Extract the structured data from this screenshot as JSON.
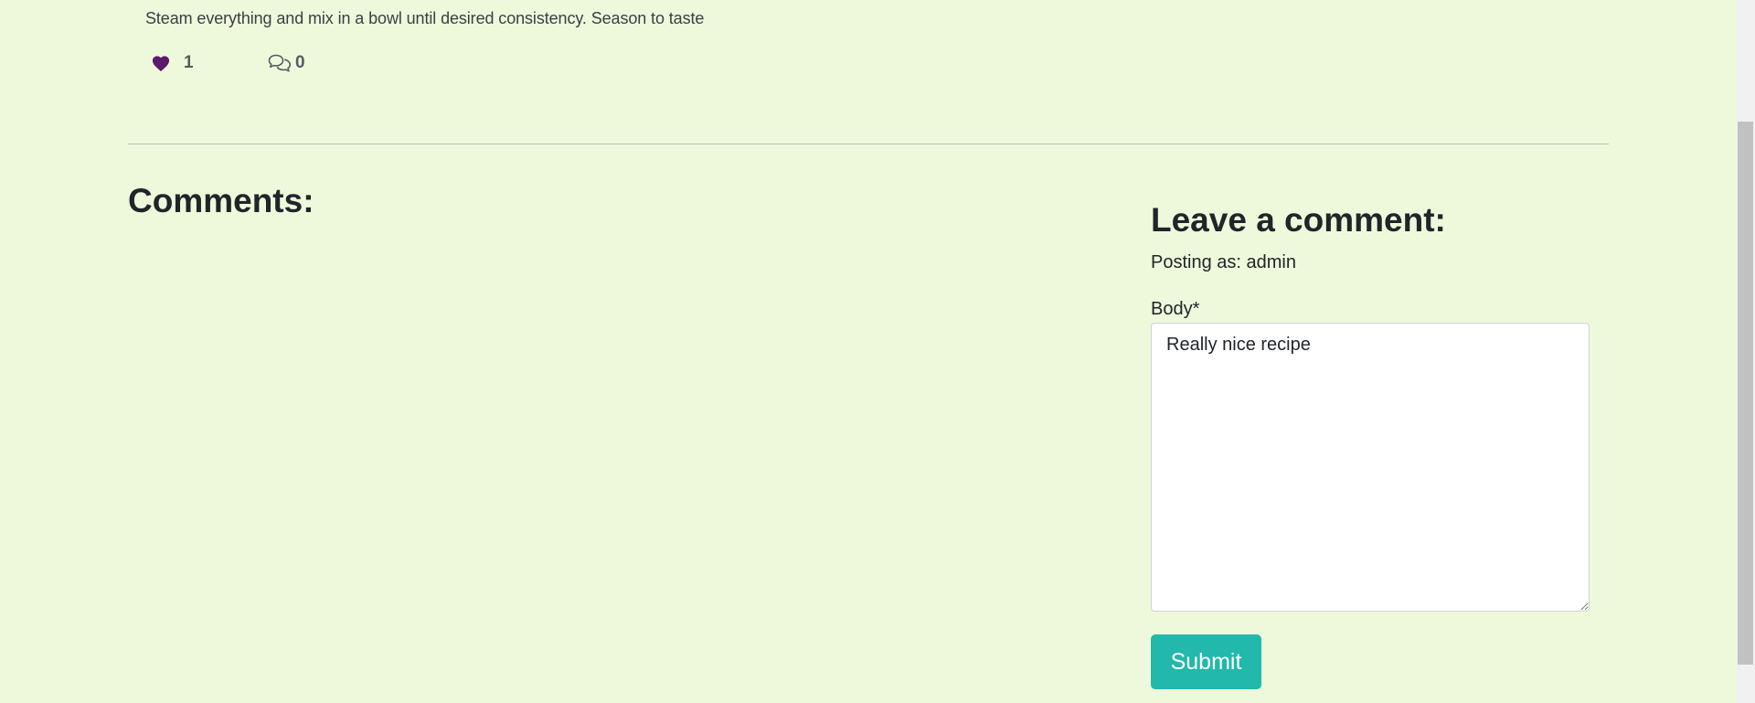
{
  "post": {
    "instructions": "Steam everything and mix in a bowl until desired consistency. Season to taste",
    "likes_count": "1",
    "comments_count": "0",
    "like_color": "#5c1a6b"
  },
  "comments_section": {
    "heading": "Comments:"
  },
  "comment_form": {
    "title": "Leave a comment:",
    "posting_as": "Posting as: admin",
    "body_label": "Body*",
    "body_value": "Really nice recipe",
    "submit_label": "Submit",
    "submit_color": "#22b8ac"
  }
}
